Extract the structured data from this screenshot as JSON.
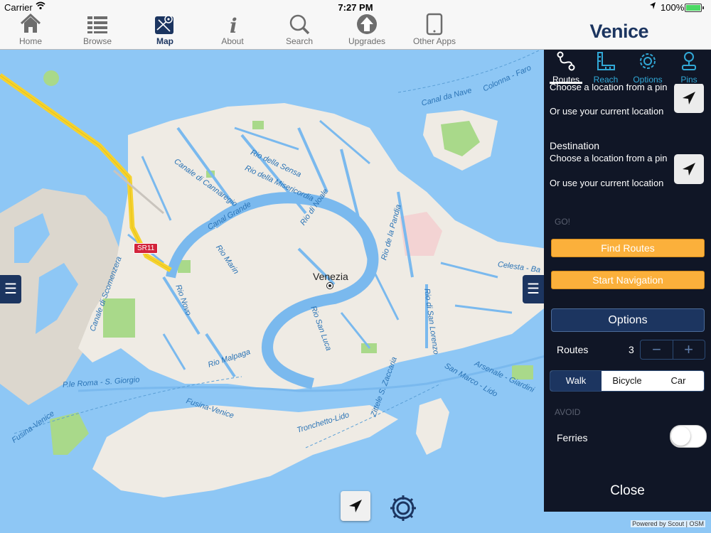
{
  "status": {
    "carrier": "Carrier",
    "time": "7:27 PM",
    "battery": "100%"
  },
  "tabs": [
    {
      "label": "Home",
      "icon": "home-icon"
    },
    {
      "label": "Browse",
      "icon": "list-icon"
    },
    {
      "label": "Map",
      "icon": "map-icon"
    },
    {
      "label": "About",
      "icon": "info-icon"
    },
    {
      "label": "Search",
      "icon": "search-icon"
    },
    {
      "label": "Upgrades",
      "icon": "upgrade-arrow-icon"
    },
    {
      "label": "Other Apps",
      "icon": "tablet-icon"
    }
  ],
  "brand": "Venice",
  "map": {
    "city": "Venezia",
    "road_badge": "SR11",
    "labels": {
      "canale_cannaregio": "Canale di Cannaregio",
      "rio_sensa": "Rio della Sensa",
      "rio_misericordia": "Rio della Misericordia",
      "rio_noale": "Rio di Noale",
      "canal_grande": "Canal Grande",
      "rio_marin": "Rio Marin",
      "rio_pandia": "Rio de la Pandia",
      "rio_novo": "Rio Novo",
      "rio_san_luca": "Rio San Luca",
      "rio_san_lorenzo": "Rio di San Lorenzo",
      "rio_malpaga": "Rio Malpaga",
      "canale_scomenzera": "Canale di Scomenzera",
      "canal_nave": "Canal da Nave",
      "colonna_faro": "Colonna - Faro",
      "celesta": "Celesta - Ba",
      "arsenale": "Arsenale - Giardini",
      "san_marco_lido": "San Marco - Lido",
      "zittele": "Zittele S. Zaccaria",
      "p_roma": "P.le Roma - S. Giorgio",
      "fusina_venice": "Fusina-Venice",
      "fusina_venice2": "Fusina-Venice",
      "tronchetto": "Tronchetto-Lido"
    },
    "attribution": "Powered by Scout | OSM"
  },
  "panel": {
    "tabs": [
      {
        "label": "Routes",
        "icon": "route-icon"
      },
      {
        "label": "Reach",
        "icon": "ruler-icon"
      },
      {
        "label": "Options",
        "icon": "gear-icon"
      },
      {
        "label": "Pins",
        "icon": "pin-icon"
      }
    ],
    "start": {
      "choose": "Choose a location from a pin",
      "current": "Or use your current location"
    },
    "destination": {
      "title": "Destination",
      "choose": "Choose a location from a pin",
      "current": "Or use your current location"
    },
    "go_label": "GO!",
    "find_routes": "Find Routes",
    "start_navigation": "Start Navigation",
    "options_button": "Options",
    "routes_label": "Routes",
    "routes_count": "3",
    "stepper_minus": "−",
    "stepper_plus": "+",
    "modes": [
      "Walk",
      "Bicycle",
      "Car"
    ],
    "selected_mode": "Walk",
    "avoid_label": "AVOID",
    "ferries_label": "Ferries",
    "ferries_on": false,
    "close": "Close"
  }
}
